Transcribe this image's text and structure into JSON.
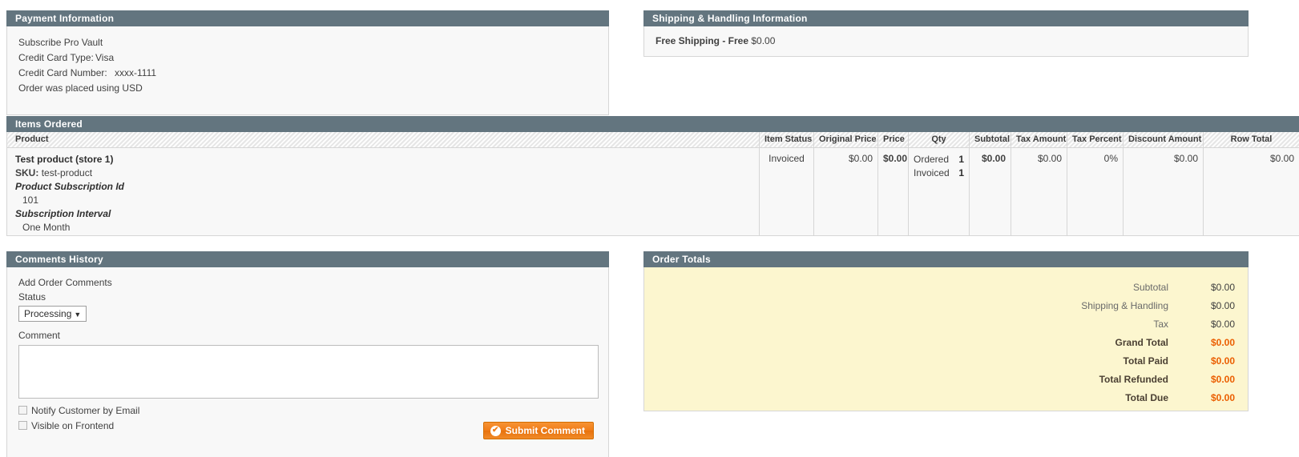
{
  "payment": {
    "heading": "Payment Information",
    "method": "Subscribe Pro Vault",
    "card_type_label": "Credit Card Type:",
    "card_type_value": "Visa",
    "card_number_label": "Credit Card Number:",
    "card_number_value": "xxxx-1111",
    "currency_note": "Order was placed using USD"
  },
  "shipping": {
    "heading": "Shipping & Handling Information",
    "method": "Free Shipping - Free",
    "price": "$0.00"
  },
  "items": {
    "heading": "Items Ordered",
    "columns": [
      "Product",
      "Item Status",
      "Original Price",
      "Price",
      "Qty",
      "Subtotal",
      "Tax Amount",
      "Tax Percent",
      "Discount Amount",
      "Row Total"
    ],
    "rows": [
      {
        "product_name": "Test product (store 1)",
        "sku_label": "SKU:",
        "sku_value": "test-product",
        "options": [
          {
            "label": "Product Subscription Id",
            "value": "101"
          },
          {
            "label": "Subscription Interval",
            "value": "One Month"
          }
        ],
        "item_status": "Invoiced",
        "original_price": "$0.00",
        "price": "$0.00",
        "qty": [
          {
            "label": "Ordered",
            "value": "1"
          },
          {
            "label": "Invoiced",
            "value": "1"
          }
        ],
        "subtotal": "$0.00",
        "tax_amount": "$0.00",
        "tax_percent": "0%",
        "discount_amount": "$0.00",
        "row_total": "$0.00"
      }
    ]
  },
  "comments": {
    "heading": "Comments History",
    "add_title": "Add Order Comments",
    "status_label": "Status",
    "status_value": "Processing",
    "status_caret": "▼",
    "comment_label": "Comment",
    "comment_value": "",
    "comment_placeholder": "",
    "notify_label": "Notify Customer by Email",
    "visible_label": "Visible on Frontend",
    "submit_label": "Submit Comment",
    "submit_icon": "✔"
  },
  "totals": {
    "heading": "Order Totals",
    "rows": [
      {
        "label": "Subtotal",
        "value": "$0.00",
        "strong": false
      },
      {
        "label": "Shipping & Handling",
        "value": "$0.00",
        "strong": false
      },
      {
        "label": "Tax",
        "value": "$0.00",
        "strong": false
      },
      {
        "label": "Grand Total",
        "value": "$0.00",
        "strong": true
      },
      {
        "label": "Total Paid",
        "value": "$0.00",
        "strong": true
      },
      {
        "label": "Total Refunded",
        "value": "$0.00",
        "strong": true
      },
      {
        "label": "Total Due",
        "value": "$0.00",
        "strong": true
      }
    ]
  },
  "colors": {
    "panel_header": "#63757f",
    "totals_background": "#fcf6cf",
    "accent_orange": "#eb5e00",
    "button_orange": "#f07c18"
  }
}
